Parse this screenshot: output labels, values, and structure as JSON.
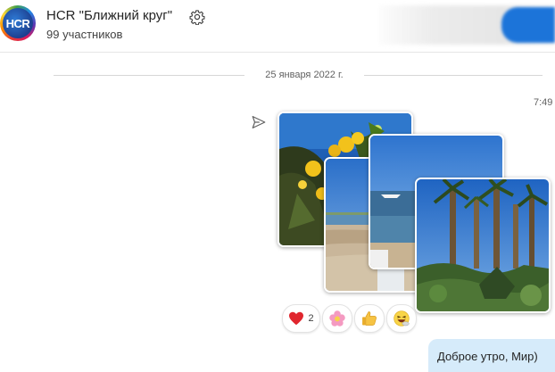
{
  "header": {
    "avatar_text": "HCR",
    "title": "HCR \"Ближний круг\"",
    "members": "99 участников"
  },
  "conversation": {
    "date_separator": "25 января 2022 г.",
    "message_time": "7:49",
    "photos": [
      {
        "subject": "yellow flowers against blue sky"
      },
      {
        "subject": "beach with sand and sea"
      },
      {
        "subject": "sea with a boat"
      },
      {
        "subject": "palm trees and garden"
      }
    ],
    "reactions": [
      {
        "icon": "heart-icon",
        "count": "2"
      },
      {
        "icon": "flower-icon",
        "count": ""
      },
      {
        "icon": "thumbs-up-icon",
        "count": ""
      },
      {
        "icon": "laughing-emoji-icon",
        "count": ""
      }
    ],
    "next_message": "Доброе утро, Мир)"
  },
  "colors": {
    "accent": "#1c74d9",
    "bubble": "#d6ebfa",
    "heart": "#e0262e"
  }
}
